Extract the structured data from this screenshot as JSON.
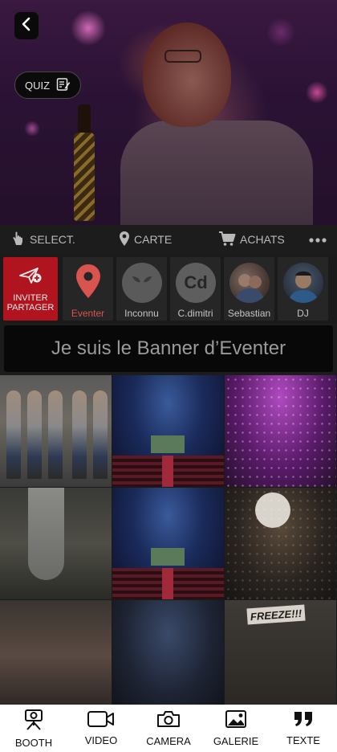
{
  "hero": {
    "quiz_label": "QUIZ"
  },
  "toolbar": {
    "select_label": "SELECT.",
    "carte_label": "CARTE",
    "achats_label": "ACHATS"
  },
  "invite": {
    "line1": "INVITER",
    "line2": "PARTAGER"
  },
  "users": [
    {
      "name": "Eventer",
      "avatar": "location-pin-icon"
    },
    {
      "name": "Inconnu",
      "avatar": "alien-icon"
    },
    {
      "name": "C.dimitri",
      "initials": "Cd"
    },
    {
      "name": "Sebastian",
      "avatar": "photo"
    },
    {
      "name": "DJ",
      "avatar": "photo"
    }
  ],
  "banner": {
    "text": "Je suis le Banner d’Eventer"
  },
  "gallery": {
    "freeze_sign": "FREEZE!!!"
  },
  "bottom_nav": [
    {
      "label": "BOOTH",
      "icon": "booth-camera-icon"
    },
    {
      "label": "VIDEO",
      "icon": "video-camera-icon"
    },
    {
      "label": "CAMERA",
      "icon": "camera-icon"
    },
    {
      "label": "GALERIE",
      "icon": "image-icon"
    },
    {
      "label": "TEXTE",
      "icon": "quote-icon"
    }
  ],
  "colors": {
    "accent_red": "#b0151f",
    "eventer_pin": "#d9534f",
    "background": "#1c1c1c"
  }
}
